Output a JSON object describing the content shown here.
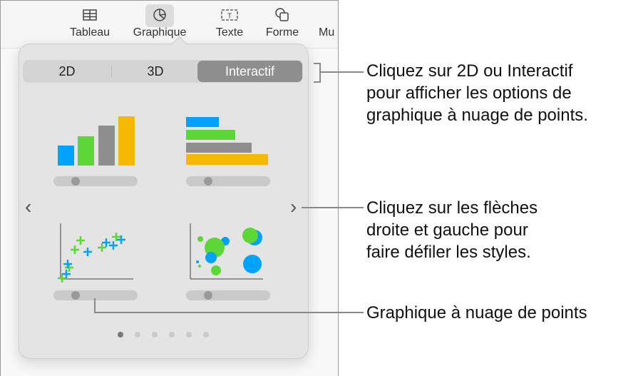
{
  "toolbar": {
    "items": [
      {
        "label": "Tableau",
        "icon": "table-icon"
      },
      {
        "label": "Graphique",
        "icon": "chart-icon",
        "active": true
      },
      {
        "label": "Texte",
        "icon": "text-box-icon"
      },
      {
        "label": "Forme",
        "icon": "shape-icon"
      },
      {
        "label": "Mu",
        "icon": "media-icon"
      }
    ]
  },
  "chart_picker": {
    "segments": [
      {
        "label": "2D",
        "selected": false
      },
      {
        "label": "3D",
        "selected": false
      },
      {
        "label": "Interactif",
        "selected": true
      }
    ],
    "tiles": [
      {
        "name": "column-chart",
        "slider_value": 0.2
      },
      {
        "name": "bar-chart",
        "slider_value": 0.2
      },
      {
        "name": "scatter-chart",
        "slider_value": 0.2
      },
      {
        "name": "bubble-chart",
        "slider_value": 0.2
      }
    ],
    "prev_arrow": "‹",
    "next_arrow": "›",
    "page_count": 6,
    "current_page": 1,
    "colors": {
      "blue": "#00a2ff",
      "green": "#5dd638",
      "gray": "#8e8e8e",
      "yellow": "#f7b900"
    }
  },
  "callouts": {
    "segments": "Cliquez sur 2D ou Interactif pour afficher les options de graphique à nuage de points.",
    "segments_lines": [
      "Cliquez sur 2D ou Interactif",
      "pour afficher les options de",
      "graphique à nuage de points."
    ],
    "arrows_lines": [
      "Cliquez sur les flèches",
      "droite et gauche pour",
      "faire défiler les styles."
    ],
    "scatter": "Graphique à nuage de points"
  }
}
